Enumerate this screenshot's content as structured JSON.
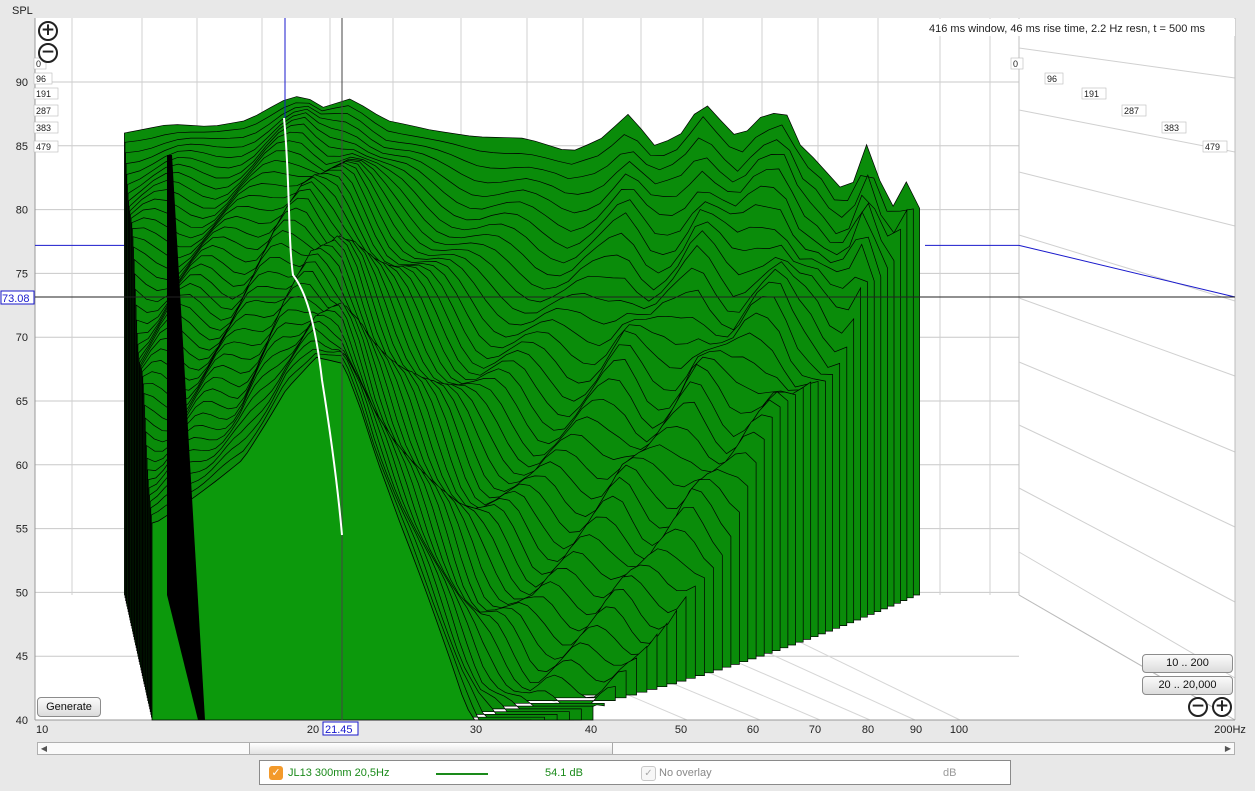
{
  "chart_data": {
    "type": "waterfall",
    "title": "416 ms window, 46 ms rise time,  2.2 Hz resn, t = 500 ms",
    "ylabel": "SPL",
    "xunit": "Hz",
    "xscale": "log",
    "xlim": [
      10,
      200
    ],
    "ylim": [
      40,
      92
    ],
    "x_ticks": [
      "10",
      "20",
      "30",
      "40",
      "50",
      "60",
      "70",
      "80",
      "90",
      "100",
      "200Hz"
    ],
    "y_ticks": [
      "40",
      "45",
      "50",
      "55",
      "60",
      "65",
      "70",
      "75",
      "80",
      "85",
      "90"
    ],
    "time_labels_left": [
      "0",
      "96",
      "191",
      "287",
      "383",
      "479"
    ],
    "time_labels_right": [
      "0",
      "96",
      "191",
      "287",
      "383",
      "479"
    ],
    "cursor": {
      "freq": 21.45,
      "freq_label": "21.45",
      "spl_label": "73.08",
      "marker_spl": 77.2
    },
    "slice_count": 46,
    "front_slice": {
      "f": [
        12.6,
        14,
        16,
        18,
        19.5,
        21,
        22,
        23,
        24.5,
        26,
        27.5,
        29,
        30.5,
        33,
        35
      ],
      "spl": [
        57,
        59,
        62,
        67.5,
        70,
        69.5,
        66,
        62,
        57,
        52.5,
        48,
        43.5,
        40,
        37,
        35
      ]
    },
    "back_slice": {
      "f": [
        12.5,
        14,
        15.5,
        17,
        18.5,
        19.5,
        20.5,
        22,
        24,
        27,
        30,
        34,
        38,
        41,
        44,
        47,
        50,
        53,
        56,
        58,
        61,
        65,
        68,
        71,
        74,
        77,
        80,
        83,
        86,
        88,
        91
      ],
      "spl": [
        86,
        86.7,
        86.5,
        87,
        88.5,
        89,
        88,
        88.7,
        87,
        86.2,
        85.7,
        85.6,
        84.5,
        85.5,
        87.5,
        85,
        85.8,
        88.5,
        86.6,
        85.5,
        87.2,
        87.8,
        84.6,
        83.7,
        81.7,
        82,
        85.4,
        81.5,
        79.8,
        82.2,
        80.1
      ]
    }
  },
  "buttons": {
    "generate": "Generate",
    "range1": "10 .. 200",
    "range2": "20 .. 20,000"
  },
  "legend": {
    "check": "✓",
    "name": "JL13 300mm 20,5Hz",
    "level": "54.1 dB",
    "overlay_check": "✓",
    "overlay": "No overlay",
    "unit": "dB"
  },
  "colors": {
    "fill": "#0a8c0a",
    "front_fill": "#0c990c",
    "stroke": "#000000",
    "cursor": "#1a1acc"
  }
}
